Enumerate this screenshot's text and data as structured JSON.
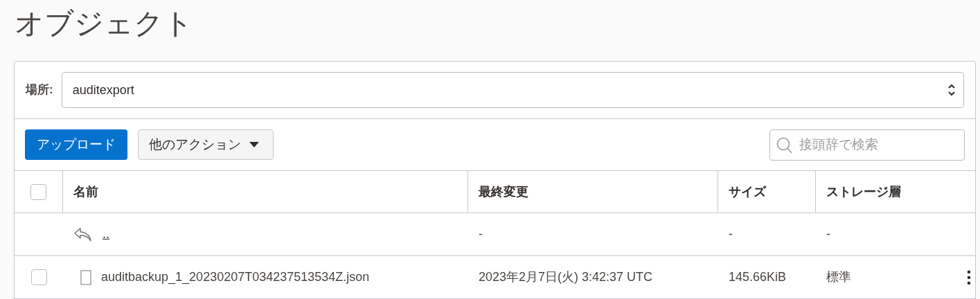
{
  "title": "オブジェクト",
  "location": {
    "label": "場所:",
    "value": "auditexport"
  },
  "toolbar": {
    "upload": "アップロード",
    "more_actions": "他のアクション",
    "search": {
      "placeholder": "接頭辞で検索"
    }
  },
  "table": {
    "select_all": {
      "checked": false
    },
    "columns": [
      "名前",
      "最終変更",
      "サイズ",
      "ストレージ層"
    ],
    "rows": [
      {
        "kind": "parent",
        "name": "..",
        "modified": "-",
        "size": "-",
        "tier": "-"
      },
      {
        "kind": "file",
        "checked": false,
        "name": "auditbackup_1_20230207T034237513534Z.json",
        "modified": "2023年2月7日(火) 3:42:37 UTC",
        "size": "145.66KiB",
        "tier": "標準"
      }
    ]
  }
}
